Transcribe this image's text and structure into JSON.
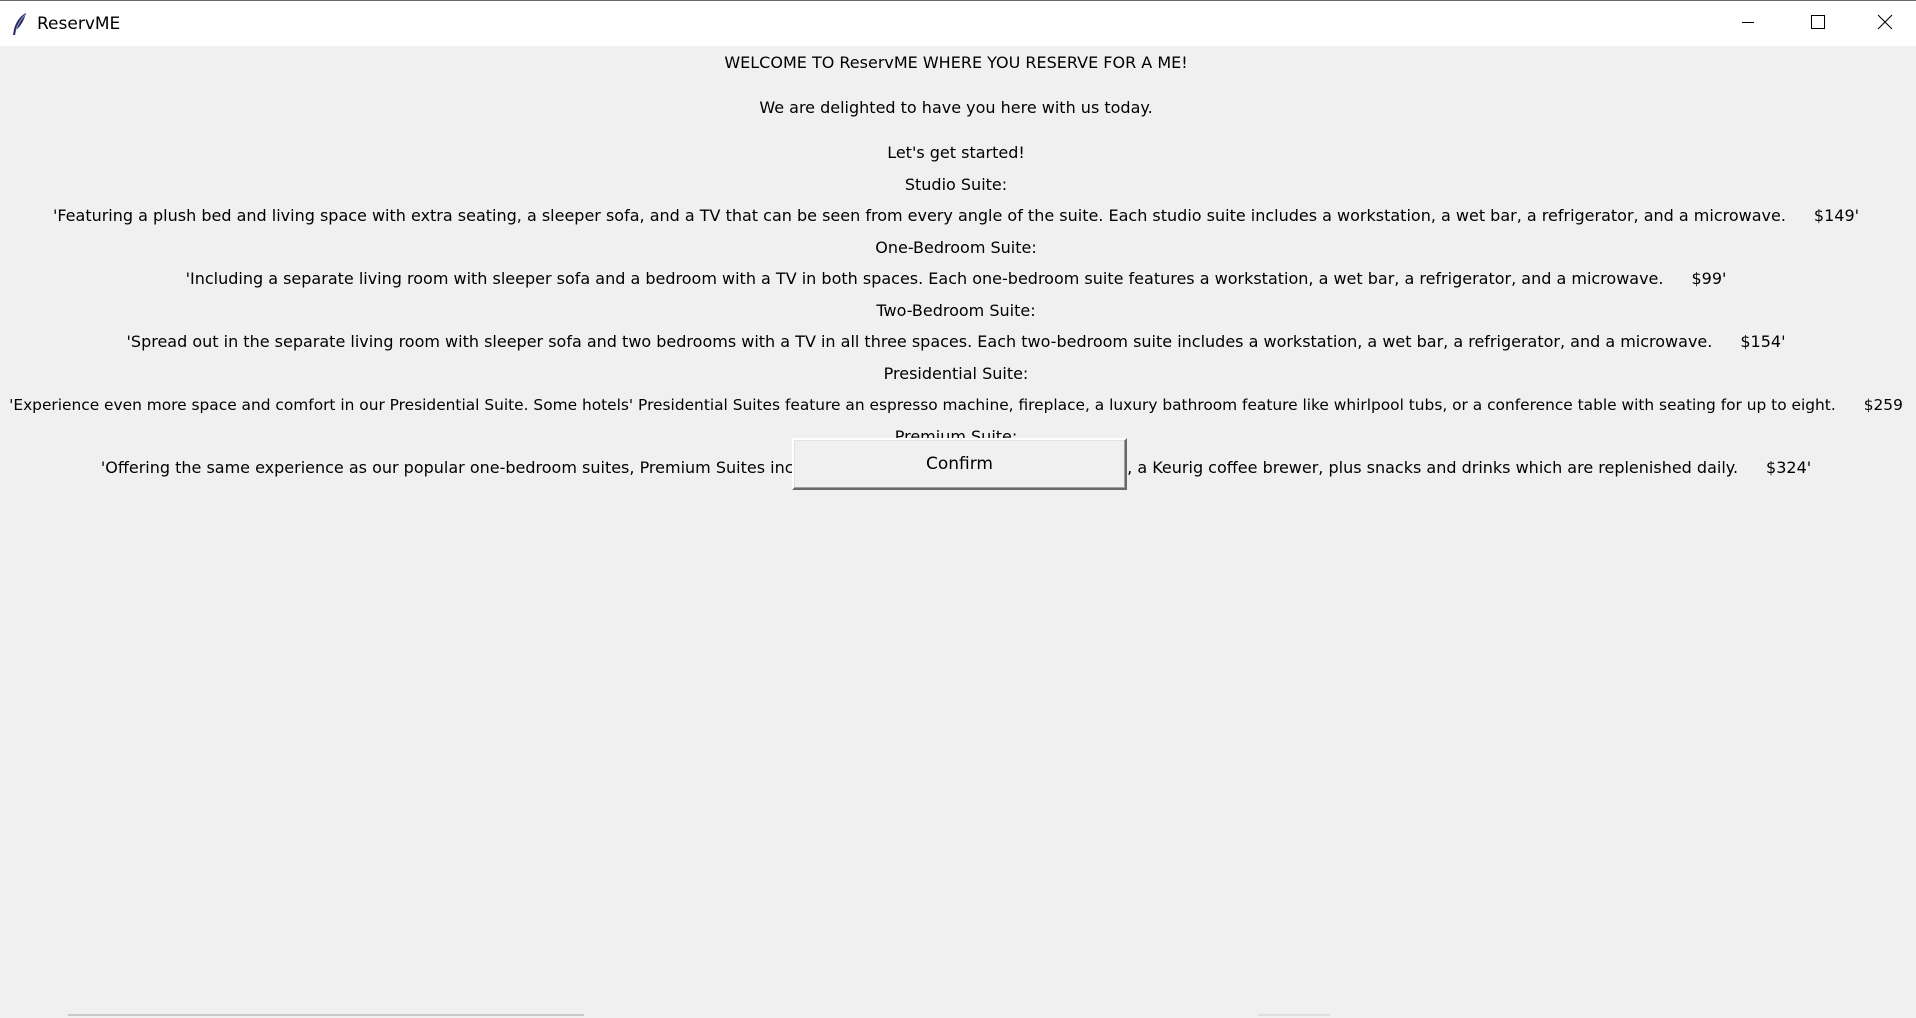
{
  "window": {
    "title": "ReservME",
    "controls": {
      "minimize_icon": "minimize-icon",
      "maximize_icon": "maximize-icon",
      "close_icon": "close-icon"
    }
  },
  "intro": {
    "welcome": "WELCOME TO ReservME WHERE YOU RESERVE FOR A ME!",
    "delighted": "We are delighted to have you here with us today.",
    "get_started": "Let's get started!"
  },
  "suites": [
    {
      "name": "Studio Suite:",
      "description": "'Featuring a plush bed and living space with extra seating, a sleeper sofa, and a TV that can be seen from every angle of the suite. Each studio suite includes a workstation, a wet bar, a refrigerator, and a microwave.",
      "price": "$149'"
    },
    {
      "name": "One-Bedroom Suite:",
      "description": "'Including a separate living room with sleeper sofa and a bedroom with a TV in both spaces. Each one-bedroom suite features a workstation, a wet bar, a refrigerator, and a microwave.",
      "price": "$99'"
    },
    {
      "name": "Two-Bedroom Suite:",
      "description": "'Spread out in the separate living room with sleeper sofa and two bedrooms with a TV in all three spaces. Each two-bedroom suite includes a workstation, a wet bar, a refrigerator, and a microwave.",
      "price": "$154'"
    },
    {
      "name": "Presidential Suite:",
      "description": "'Experience even more space and comfort in our Presidential Suite. Some hotels' Presidential Suites feature an espresso machine, fireplace, a luxury bathroom feature like whirlpool tubs, or a conference table with seating for up to eight.",
      "price": "$259"
    },
    {
      "name": "Premium Suite:",
      "description": "'Offering the same experience as our popular one-bedroom suites, Premium Suites include additional upgrades of Premium WiFi, a Keurig coffee brewer, plus snacks and drinks which are replenished daily.",
      "price": "$324'"
    }
  ],
  "confirm_label": "Confirm"
}
